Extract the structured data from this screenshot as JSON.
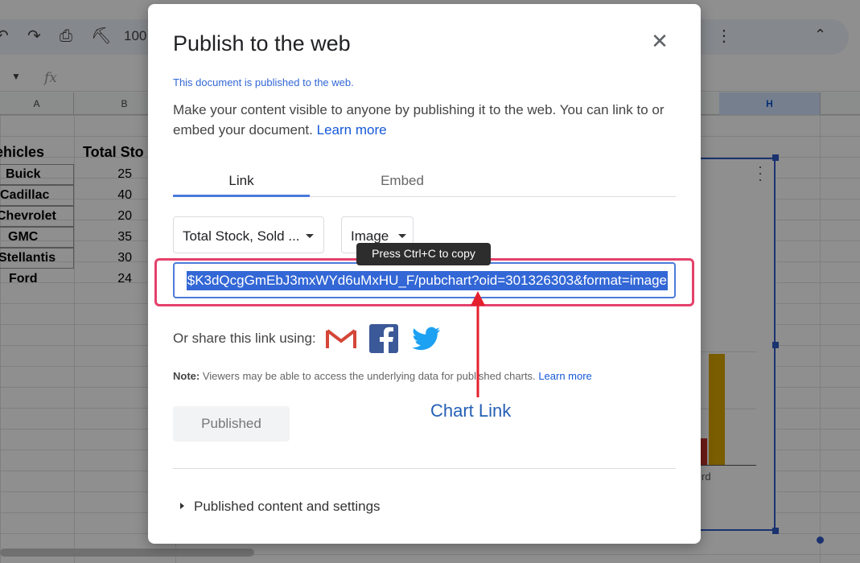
{
  "sheet": {
    "columns": [
      "A",
      "B",
      "H"
    ],
    "headers": {
      "vehicles": "ehicles",
      "total_stock": "Total Sto"
    },
    "rows": [
      {
        "vehicle": "Buick",
        "stock": "25"
      },
      {
        "vehicle": "Cadillac",
        "stock": "40"
      },
      {
        "vehicle": "Chevrolet",
        "stock": "20"
      },
      {
        "vehicle": "GMC",
        "stock": "35"
      },
      {
        "vehicle": "Stellantis",
        "stock": "30"
      },
      {
        "vehicle": "Ford",
        "stock": "24"
      }
    ],
    "zoom": "100",
    "chart_axis_label": "rd"
  },
  "dialog": {
    "title": "Publish to the web",
    "status": "This document is published to the web.",
    "description": "Make your content visible to anyone by publishing it to the web. You can link to or embed your document.",
    "learn_more": "Learn more",
    "tabs": {
      "link": "Link",
      "embed": "Embed"
    },
    "chart_select": "Total Stock, Sold ...",
    "format_select": "Image",
    "tooltip": "Press Ctrl+C to copy",
    "url": "$K3dQcgGmEbJ3mxWYd6uMxHU_F/pubchart?oid=301326303&format=image",
    "share_label": "Or share this link using:",
    "note_label": "Note:",
    "note_text": "Viewers may be able to access the underlying data for published charts.",
    "note_link": "Learn more",
    "published_button": "Published",
    "expander": "Published content and settings"
  },
  "annotation": {
    "label": "Chart Link",
    "color": "#e5202e"
  },
  "colors": {
    "accent": "#4a7bd9",
    "highlight": "#e5416b",
    "link": "#1558d6"
  }
}
